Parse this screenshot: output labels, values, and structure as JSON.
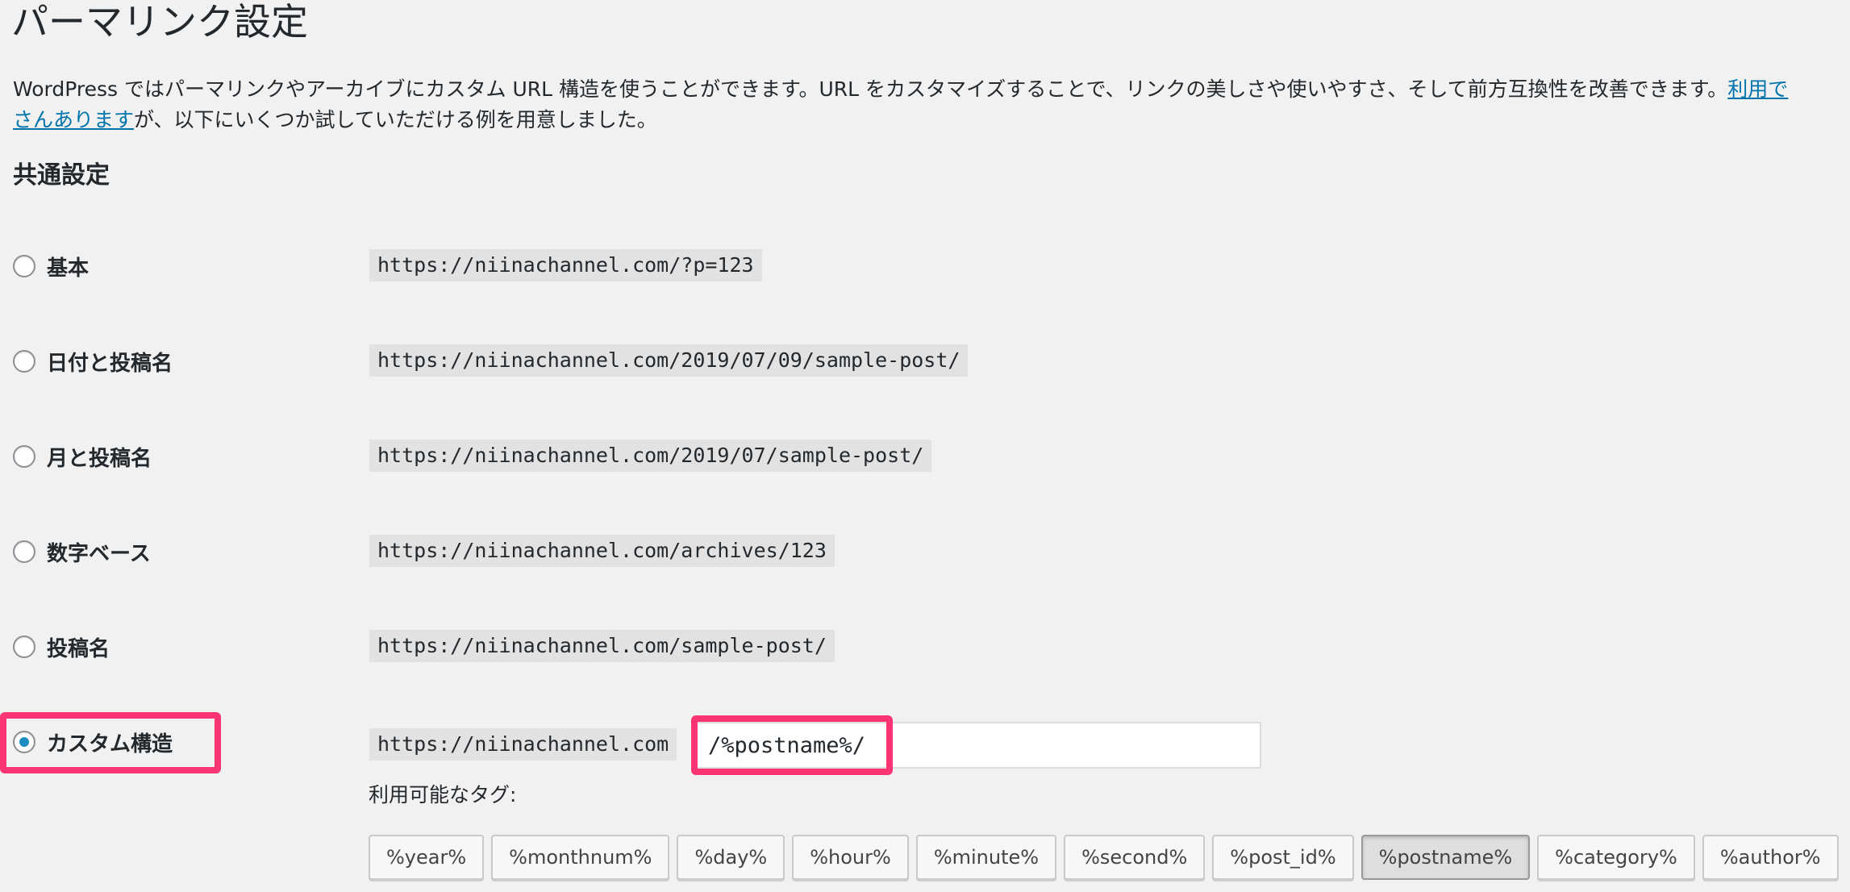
{
  "page": {
    "title": "パーマリンク設定",
    "intro_text": "WordPress ではパーマリンクやアーカイブにカスタム URL 構造を使うことができます。URL をカスタマイズすることで、リンクの美しさや使いやすさ、そして前方互換性を改善できます。",
    "intro_link_part1": "利用で",
    "intro_link_part2": "さんあります",
    "intro_text_tail": "が、以下にいくつか試していただける例を用意しました。"
  },
  "common_settings": {
    "title": "共通設定",
    "options": [
      {
        "label": "基本",
        "example": "https://niinachannel.com/?p=123",
        "selected": false
      },
      {
        "label": "日付と投稿名",
        "example": "https://niinachannel.com/2019/07/09/sample-post/",
        "selected": false
      },
      {
        "label": "月と投稿名",
        "example": "https://niinachannel.com/2019/07/sample-post/",
        "selected": false
      },
      {
        "label": "数字ベース",
        "example": "https://niinachannel.com/archives/123",
        "selected": false
      },
      {
        "label": "投稿名",
        "example": "https://niinachannel.com/sample-post/",
        "selected": false
      },
      {
        "label": "カスタム構造",
        "example": "https://niinachannel.com",
        "selected": true
      }
    ],
    "custom_structure_value": "/%postname%/",
    "available_tags_label": "利用可能なタグ:",
    "tags": [
      "%year%",
      "%monthnum%",
      "%day%",
      "%hour%",
      "%minute%",
      "%second%",
      "%post_id%",
      "%postname%",
      "%category%",
      "%author%"
    ],
    "active_tag": "%postname%"
  },
  "colors": {
    "highlight": "#fb3573",
    "link": "#0073aa",
    "radio_checked": "#1e8cbe"
  }
}
